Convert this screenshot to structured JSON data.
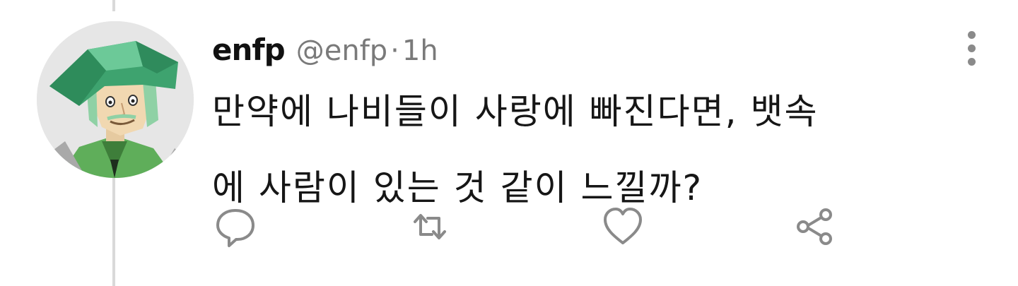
{
  "tweet": {
    "display_name": "enfp",
    "handle": "@enfp",
    "separator": "·",
    "time": "1h",
    "text": "만약에 나비들이 사랑에 빠진다면, 뱃속\n에 사람이 있는 것 같이 느낄까?"
  },
  "icons": {
    "avatar": "green-hat-character-avatar",
    "more": "vertical-ellipsis-icon",
    "reply": "speech-bubble-icon",
    "retweet": "retweet-arrows-icon",
    "like": "heart-outline-icon",
    "share": "share-nodes-icon"
  },
  "colors": {
    "name_highlight": "#46bec8",
    "muted_text": "#7a7a7a",
    "icon_gray": "#8a8a8a",
    "avatar_green": "#4caf7d"
  }
}
